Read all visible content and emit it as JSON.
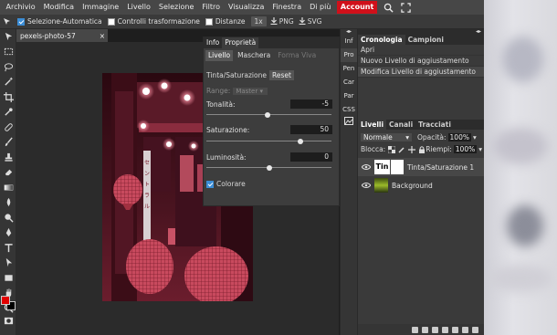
{
  "menubar": {
    "items": [
      "Archivio",
      "Modifica",
      "Immagine",
      "Livello",
      "Selezione",
      "Filtro",
      "Visualizza",
      "Finestra",
      "Di più"
    ],
    "account_label": "Account"
  },
  "optbar": {
    "auto_select_label": "Selezione-Automatica",
    "transform_controls_label": "Controlli trasformazione",
    "distances_label": "Distanze",
    "zoom_value": "1x",
    "png_label": "PNG",
    "svg_label": "SVG"
  },
  "document": {
    "tab_title": "pexels-photo-57",
    "close_glyph": "×"
  },
  "properties": {
    "tabs": [
      "Info",
      "Proprietà"
    ],
    "subtabs": [
      "Livello",
      "Maschera",
      "Forma Viva"
    ],
    "adjustment_title": "Tinta/Saturazione",
    "reset_label": "Reset",
    "range_label": "Range:",
    "range_value": "Master",
    "hue_label": "Tonalità:",
    "hue_value": "-5",
    "hue_fraction": 0.49,
    "saturation_label": "Saturazione:",
    "saturation_value": "50",
    "saturation_fraction": 0.75,
    "lightness_label": "Luminosità:",
    "lightness_value": "0",
    "lightness_fraction": 0.5,
    "colorize_label": "Colorare"
  },
  "mini_panel": {
    "items": [
      "Inf",
      "Pro",
      "Pen",
      "Car",
      "Par",
      "CSS"
    ]
  },
  "history": {
    "tabs": [
      "Cronologia",
      "Campioni"
    ],
    "items": [
      "Apri",
      "Nuovo Livello di aggiustamento",
      "Modifica Livello di aggiustamento"
    ]
  },
  "layers": {
    "tabs": [
      "Livelli",
      "Canali",
      "Tracciati"
    ],
    "blend_mode": "Normale",
    "opacity_label": "Opacità:",
    "opacity_value": "100%",
    "lock_label": "Blocca:",
    "fill_label": "Riempi:",
    "fill_value": "100%",
    "items": [
      {
        "name": "Tinta/Saturazione 1",
        "thumb_text": "Tin"
      },
      {
        "name": "Background"
      }
    ]
  },
  "colors": {
    "foreground": "#e20000",
    "background": "#000000",
    "accent": "#d0101a",
    "photo_tint": "#c1364a"
  }
}
